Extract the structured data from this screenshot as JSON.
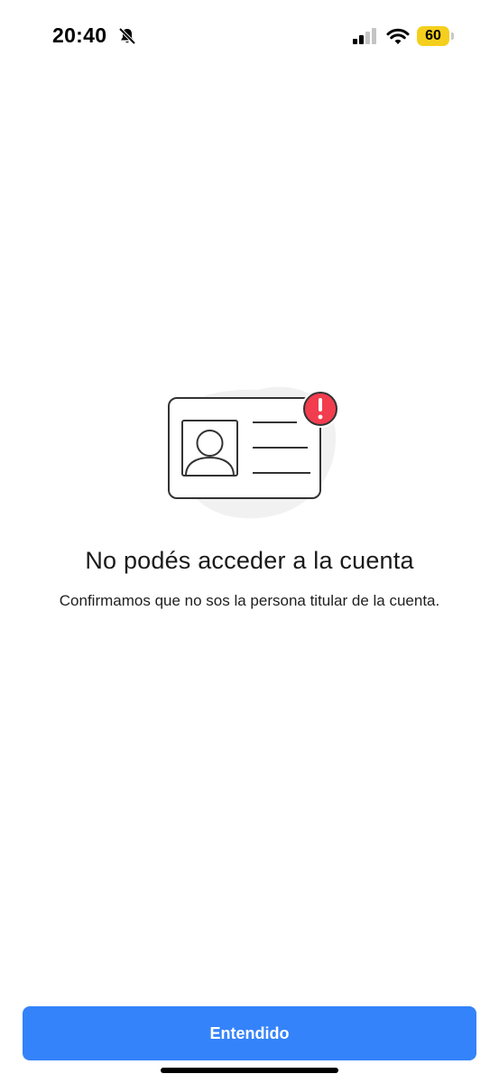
{
  "status_bar": {
    "time": "20:40",
    "battery_level": "60",
    "icons": [
      "bell-slash-icon",
      "signal-icon",
      "wifi-icon",
      "battery-icon"
    ],
    "battery_color": "#f5cf1d"
  },
  "illustration": {
    "icons": [
      "id-card-icon",
      "person-silhouette-icon",
      "alert-badge-icon"
    ],
    "alert_color": "#f23d4f"
  },
  "content": {
    "title": "No podés acceder a la cuenta",
    "message": "Confirmamos que no sos la persona titular de la cuenta."
  },
  "actions": {
    "primary_label": "Entendido",
    "primary_color": "#3483fa"
  }
}
